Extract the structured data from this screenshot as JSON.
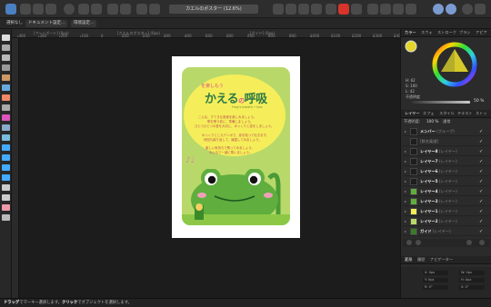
{
  "toolbar": {
    "doc_title": "カエルのポスター (12.6%)",
    "buttons": [
      "app-menu-icon",
      "persona-designer-icon",
      "persona-pixel-icon",
      "persona-export-icon",
      "grid-icon",
      "undo-icon",
      "redo-icon",
      "move-icon",
      "snapping-icon",
      "insert-icon",
      "order-icon",
      "align-icon",
      "boolean-icon",
      "color-icon",
      "studio-icon",
      "assistant-icon"
    ],
    "colors": {
      "accent": "#4a90d9",
      "red": "#d9342b"
    }
  },
  "context": {
    "mode_label": "選択なし",
    "doc_setup_label": "ドキュメント設定...",
    "prefs_label": "環境設定..."
  },
  "ruler": {
    "top_labels": [
      "-400",
      "-300",
      "-200",
      "-100",
      "0",
      "100",
      "200",
      "300",
      "400",
      "500",
      "600",
      "700",
      "800",
      "900",
      "1000",
      "1100",
      "1200",
      "1300",
      "1400"
    ],
    "section_labels": [
      "[アートボード] (0px)",
      "[カエルのポスター] (0px)",
      "[ガイド] (0px)"
    ]
  },
  "poster": {
    "subtitle": "を楽しもう",
    "title_a": "かえる",
    "title_no": "の",
    "title_b": "呼吸",
    "en": "Frog's breath • tips",
    "lines": [
      "こんな、すてきな音楽を楽しみましょう。",
      "歌を歌う前に、準備しましょう。",
      "ひとつひとつの音を大切に、ゆっくりと息をしましょう。",
      "",
      "ゆっくりとしたテンポで、息を吸って吐きます。",
      "何回も繰り返して、練習してみましょう。",
      "",
      "楽しい気持ちで歌ってみましょう。",
      "みんなで一緒に歌いましょう。"
    ],
    "notes": "♪♩",
    "frog_color": "#5fae3e",
    "bubble_color": "#f5ee5a",
    "card_color": "#b8d96a"
  },
  "color_panel": {
    "tabs": [
      "カラー",
      "スウォ",
      "ストローク",
      "ブラシ",
      "アピア"
    ],
    "h_label": "H: 62",
    "s_label": "S: 100",
    "l_label": "L: 42",
    "opacity_label": "不透明度",
    "opacity_value": "50 %",
    "fill_color": "#e3d52a"
  },
  "layers_panel": {
    "tabs": [
      "レイヤー",
      "エフェ",
      "スタイル",
      "テキスト",
      "ストッ"
    ],
    "opacity_label": "不透明度:",
    "opacity_value": "100 %",
    "blend_label": "通常",
    "layers": [
      {
        "name": "メンバー",
        "kind": "(グループ)",
        "visible": "✓",
        "selected": false
      },
      {
        "name": "[数名楽譜]",
        "kind": "",
        "visible": "✓",
        "selected": false
      },
      {
        "name": "レイヤー8",
        "kind": "(レイヤー)",
        "visible": "✓",
        "selected": false
      },
      {
        "name": "レイヤー7",
        "kind": "(レイヤー)",
        "visible": "✓",
        "selected": false
      },
      {
        "name": "レイヤー6",
        "kind": "(レイヤー)",
        "visible": "✓",
        "selected": false
      },
      {
        "name": "レイヤー5",
        "kind": "(レイヤー)",
        "visible": "✓",
        "selected": false
      },
      {
        "name": "レイヤー4",
        "kind": "(レイヤー)",
        "visible": "✓",
        "selected": false
      },
      {
        "name": "レイヤー3",
        "kind": "(レイヤー)",
        "visible": "✓",
        "selected": false
      },
      {
        "name": "レイヤー1",
        "kind": "(レイヤー)",
        "visible": "✓",
        "selected": false
      },
      {
        "name": "レイヤー2",
        "kind": "(レイヤー)",
        "visible": "✓",
        "selected": false
      },
      {
        "name": "ガイド",
        "kind": "(レイヤー)",
        "visible": "✓",
        "selected": false
      }
    ]
  },
  "transform_panel": {
    "tabs": [
      "変形",
      "履歴",
      "ナビゲーター"
    ],
    "x": "X: 0px",
    "y": "Y: 0px",
    "w": "W: 0px",
    "h": "H: 0px",
    "r": "R: 0°",
    "s": "S: 0°"
  },
  "status": {
    "drag_label": "ドラッグ",
    "drag_text": "でマーキー選択します。",
    "click_label": "クリック",
    "click_text": "でオブジェクトを選択します。"
  }
}
